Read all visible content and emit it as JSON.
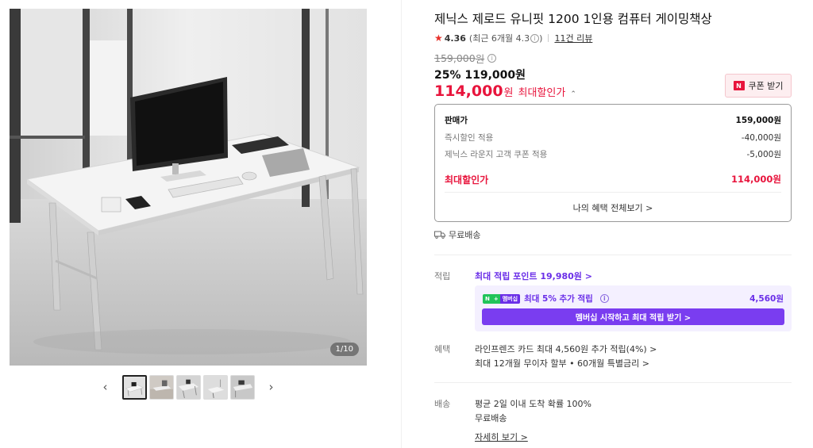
{
  "gallery": {
    "counter": "1/10",
    "prev_icon": "chevron-left-icon",
    "next_icon": "chevron-right-icon",
    "thumbnail_count": 5
  },
  "product": {
    "title": "제닉스 제로드 유니핏 1200 1인용 컴퓨터 게이밍책상",
    "rating": "4.36",
    "rating_recent": "(최근 6개월 4.3",
    "rating_recent_close": ")",
    "review_link": "11건 리뷰"
  },
  "price": {
    "original": "159,000",
    "original_unit": "원",
    "discount_line": "25% 119,000원",
    "final": "114,000",
    "final_unit": "원",
    "final_label": "최대할인가",
    "coupon_button": "쿠폰 받기",
    "coupon_badge": "N"
  },
  "price_box": {
    "rows": [
      {
        "label": "판매가",
        "value": "159,000원"
      },
      {
        "label": "즉시할인 적용",
        "value": "-40,000원"
      },
      {
        "label": "제닉스 라운지 고객 쿠폰 적용",
        "value": "-5,000원"
      },
      {
        "label": "최대할인가",
        "value": "114,000원"
      }
    ],
    "all_benefits": "나의 혜택 전체보기 >"
  },
  "shipping": {
    "label": "무료배송"
  },
  "points": {
    "section_label": "적립",
    "max_points": "최대 적립 포인트 19,980원 >",
    "member_badge_n": "N",
    "member_badge_plus": "+",
    "member_badge_text": "멤버십",
    "member_extra": "최대 5% 추가 적립",
    "member_amount": "4,560원",
    "member_button": "멤버십 시작하고 최대 적립 받기 >"
  },
  "benefits": {
    "section_label": "혜택",
    "line1": "라인프렌즈 카드 최대 4,560원 추가 적립(4%) >",
    "line2": "최대 12개월 무이자 할부 • 60개월 특별금리 >"
  },
  "delivery": {
    "section_label": "배송",
    "line1": "평균 2일 이내 도착 확률 100%",
    "line2": "무료배송",
    "detail_link": "자세히 보기 >"
  },
  "colors": {
    "accent_red": "#e8143c",
    "accent_purple": "#6a2ee8",
    "star": "#e8322b"
  }
}
